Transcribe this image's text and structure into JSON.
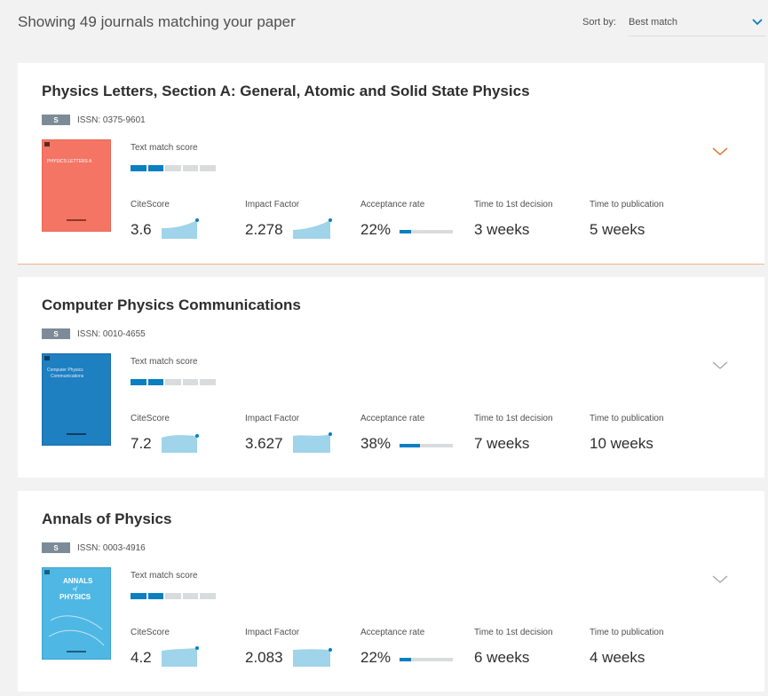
{
  "header": {
    "results_text": "Showing 49 journals matching your paper",
    "sort_label": "Sort by:",
    "sort_value": "Best match"
  },
  "colors": {
    "accent_blue": "#0a7fc1",
    "sparkline_fill": "#9fd4ea",
    "active_card_border": "#f2b38b",
    "expand_chevron_active": "#e07a3a",
    "expand_chevron_inactive": "#a0a0a0"
  },
  "labels": {
    "text_match_score": "Text match score",
    "citescore": "CiteScore",
    "impact_factor": "Impact Factor",
    "acceptance_rate": "Acceptance rate",
    "time_first_decision": "Time to 1st decision",
    "time_publication": "Time to publication",
    "s_badge": "S"
  },
  "journals": [
    {
      "title": "Physics Letters, Section A: General, Atomic and Solid State Physics",
      "issn": "ISSN: 0375-9601",
      "cover_color": "#f47564",
      "cover_text": "PHYSICS LETTERS A",
      "text_match_segments": 2,
      "text_match_total": 5,
      "citescore": "3.6",
      "impact_factor": "2.278",
      "acceptance_rate": "22%",
      "acceptance_fraction": 0.22,
      "time_first_decision": "3 weeks",
      "time_publication": "5 weeks",
      "expanded_indicator": "chevron-down-orange"
    },
    {
      "title": "Computer Physics Communications",
      "issn": "ISSN: 0010-4655",
      "cover_color": "#1e7fc1",
      "cover_text": "Computer Physics Communications",
      "text_match_segments": 2,
      "text_match_total": 5,
      "citescore": "7.2",
      "impact_factor": "3.627",
      "acceptance_rate": "38%",
      "acceptance_fraction": 0.38,
      "time_first_decision": "7 weeks",
      "time_publication": "10 weeks",
      "expanded_indicator": "chevron-down-gray"
    },
    {
      "title": "Annals of Physics",
      "issn": "ISSN: 0003-4916",
      "cover_color": "#4fb7e3",
      "cover_text": "ANNALS of PHYSICS",
      "text_match_segments": 2,
      "text_match_total": 5,
      "citescore": "4.2",
      "impact_factor": "2.083",
      "acceptance_rate": "22%",
      "acceptance_fraction": 0.22,
      "time_first_decision": "6 weeks",
      "time_publication": "4 weeks",
      "expanded_indicator": "chevron-down-gray"
    }
  ]
}
